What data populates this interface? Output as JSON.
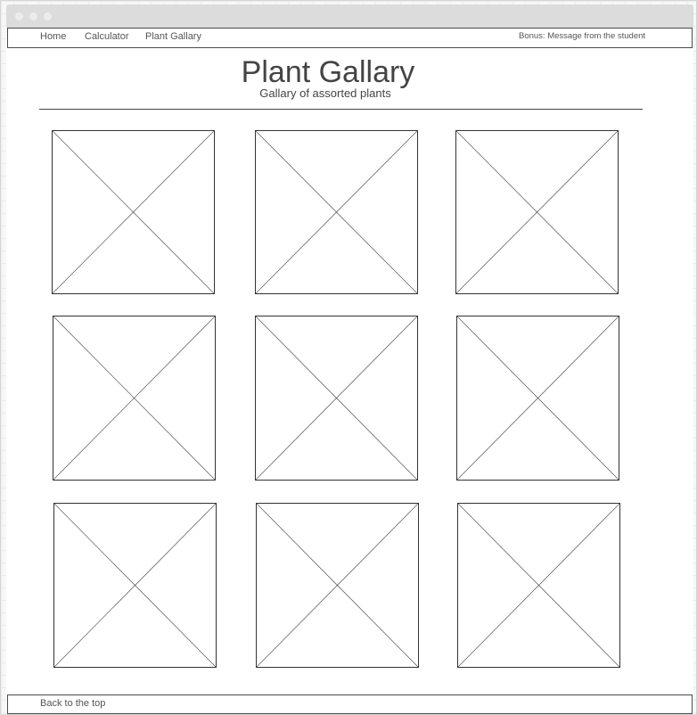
{
  "nav": {
    "links": [
      {
        "label": "Home"
      },
      {
        "label": "Calculator"
      },
      {
        "label": "Plant Gallary"
      }
    ],
    "bonus_label": "Bonus: Message from the student"
  },
  "header": {
    "title": "Plant Gallary",
    "subtitle": "Gallary of assorted plants"
  },
  "gallery": {
    "columns": 3,
    "rows": 3,
    "image_placeholder_count": 9
  },
  "footer": {
    "back_to_top_label": "Back to the top"
  },
  "colors": {
    "line": "#333333",
    "text": "#444444",
    "nav_text": "#555555",
    "titlebar": "#dcdcdc"
  }
}
